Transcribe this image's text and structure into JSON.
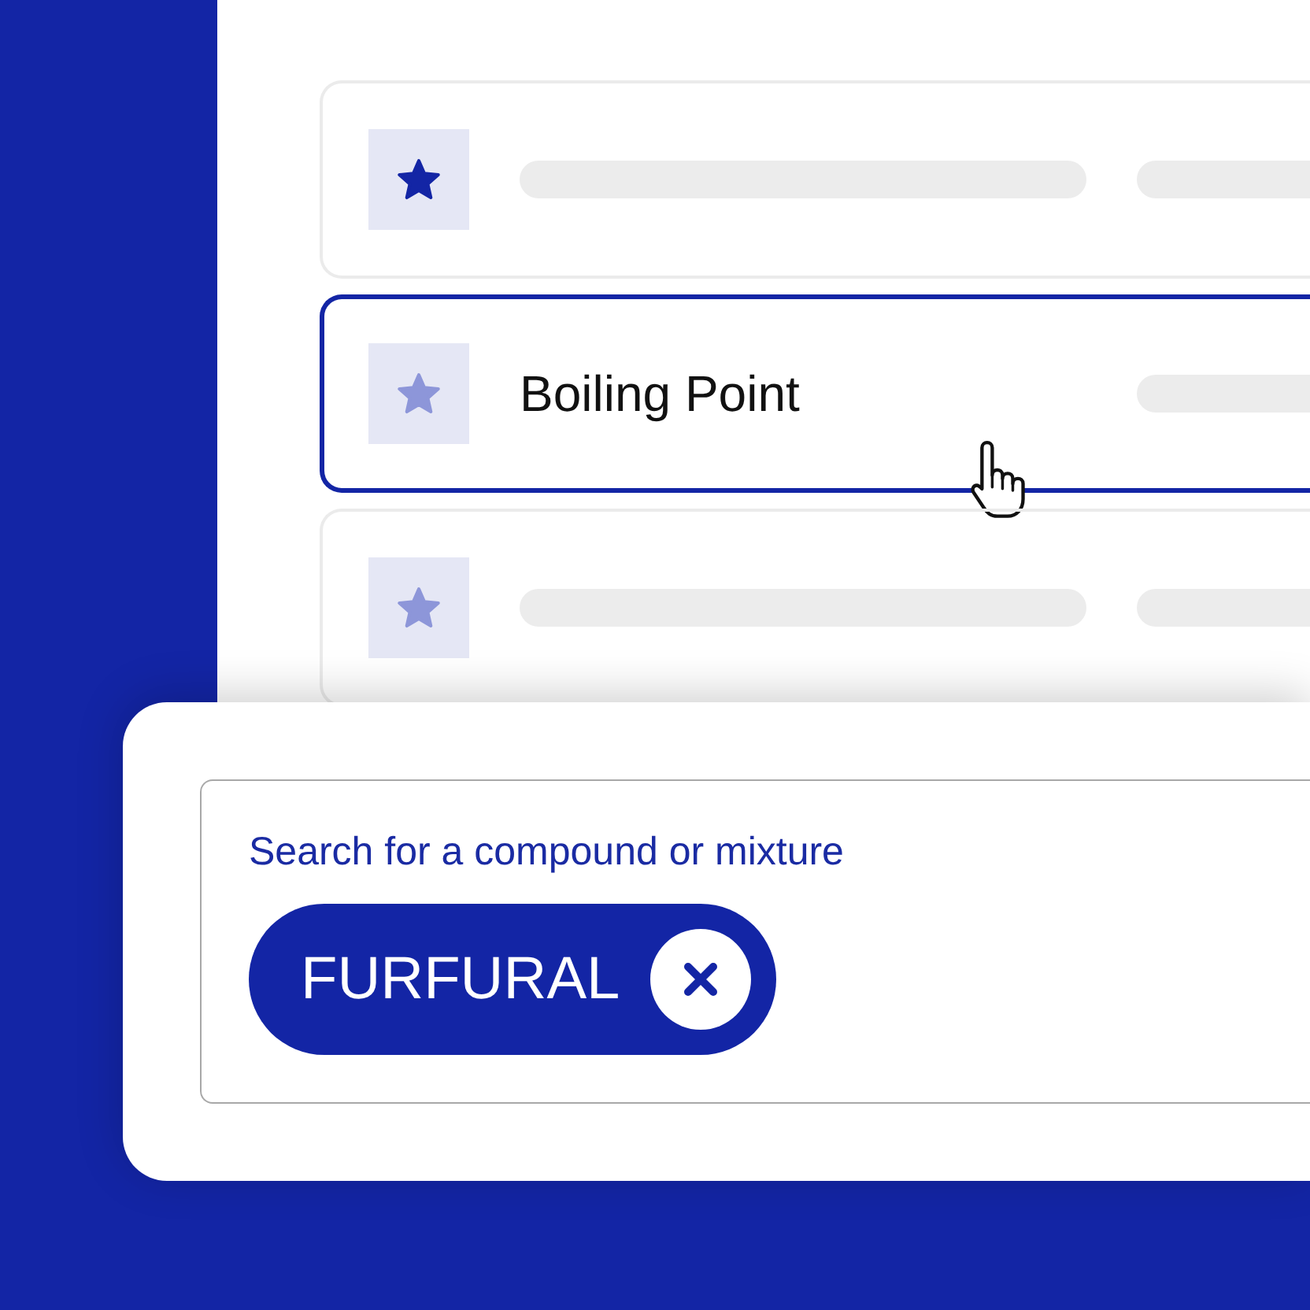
{
  "list": {
    "rows": [
      {
        "kind": "skeleton",
        "starred": true,
        "selected": false,
        "hovered": false
      },
      {
        "kind": "label",
        "label": "Boiling Point",
        "starred": false,
        "selected": true,
        "hovered": true
      },
      {
        "kind": "skeleton",
        "starred": false,
        "selected": false,
        "hovered": false
      }
    ]
  },
  "search": {
    "label": "Search for a compound or mixture",
    "chips": [
      {
        "text": "FURFURAL"
      }
    ]
  }
}
